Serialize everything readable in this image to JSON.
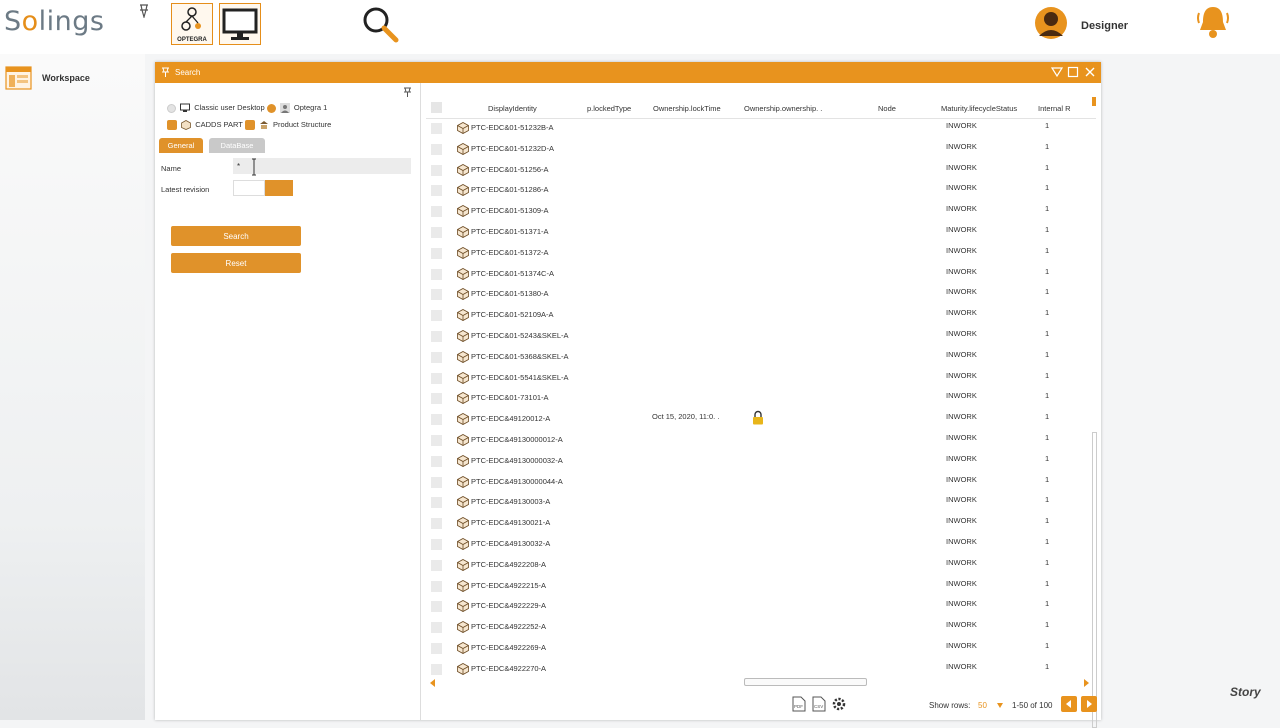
{
  "brand": {
    "logo_prefix": "S",
    "logo_ring": "o",
    "logo_suffix": "lings"
  },
  "apps": {
    "optegra_label": "OPTEGRA"
  },
  "user": {
    "name": "Designer"
  },
  "sidebar": {
    "workspace_label": "Workspace"
  },
  "window": {
    "title": "Search"
  },
  "sources": {
    "classic_desktop": "Classic user Desktop",
    "optegra": "Optegra 1",
    "cadds_part": "CADDS PART",
    "product_structure": "Product Structure"
  },
  "tabs": {
    "general": "General",
    "database": "DataBase"
  },
  "form": {
    "name_label": "Name",
    "name_value": "*",
    "latest_revision_label": "Latest revision",
    "search_button": "Search",
    "reset_button": "Reset"
  },
  "grid": {
    "columns": [
      "DisplayIdentity",
      "p.lockedType",
      "Ownership.lockTime",
      "Ownership.ownership. .",
      "Node",
      "Maturity.lifecycleStatus",
      "Internal R"
    ],
    "rows": [
      {
        "identity": "PTC-EDC&01-51232B-A",
        "lock_time": "",
        "locked": false,
        "status": "INWORK",
        "rev": "1"
      },
      {
        "identity": "PTC-EDC&01-51232D-A",
        "lock_time": "",
        "locked": false,
        "status": "INWORK",
        "rev": "1"
      },
      {
        "identity": "PTC-EDC&01-51256-A",
        "lock_time": "",
        "locked": false,
        "status": "INWORK",
        "rev": "1"
      },
      {
        "identity": "PTC-EDC&01-51286-A",
        "lock_time": "",
        "locked": false,
        "status": "INWORK",
        "rev": "1"
      },
      {
        "identity": "PTC-EDC&01-51309-A",
        "lock_time": "",
        "locked": false,
        "status": "INWORK",
        "rev": "1"
      },
      {
        "identity": "PTC-EDC&01-51371-A",
        "lock_time": "",
        "locked": false,
        "status": "INWORK",
        "rev": "1"
      },
      {
        "identity": "PTC-EDC&01-51372-A",
        "lock_time": "",
        "locked": false,
        "status": "INWORK",
        "rev": "1"
      },
      {
        "identity": "PTC-EDC&01-51374C-A",
        "lock_time": "",
        "locked": false,
        "status": "INWORK",
        "rev": "1"
      },
      {
        "identity": "PTC-EDC&01-51380-A",
        "lock_time": "",
        "locked": false,
        "status": "INWORK",
        "rev": "1"
      },
      {
        "identity": "PTC-EDC&01-52109A-A",
        "lock_time": "",
        "locked": false,
        "status": "INWORK",
        "rev": "1"
      },
      {
        "identity": "PTC-EDC&01-5243&SKEL-A",
        "lock_time": "",
        "locked": false,
        "status": "INWORK",
        "rev": "1"
      },
      {
        "identity": "PTC-EDC&01-5368&SKEL-A",
        "lock_time": "",
        "locked": false,
        "status": "INWORK",
        "rev": "1"
      },
      {
        "identity": "PTC-EDC&01-5541&SKEL-A",
        "lock_time": "",
        "locked": false,
        "status": "INWORK",
        "rev": "1"
      },
      {
        "identity": "PTC-EDC&01-73101-A",
        "lock_time": "",
        "locked": false,
        "status": "INWORK",
        "rev": "1"
      },
      {
        "identity": "PTC-EDC&49120012-A",
        "lock_time": "Oct 15, 2020, 11:0. .",
        "locked": true,
        "status": "INWORK",
        "rev": "1"
      },
      {
        "identity": "PTC-EDC&49130000012-A",
        "lock_time": "",
        "locked": false,
        "status": "INWORK",
        "rev": "1"
      },
      {
        "identity": "PTC-EDC&49130000032-A",
        "lock_time": "",
        "locked": false,
        "status": "INWORK",
        "rev": "1"
      },
      {
        "identity": "PTC-EDC&49130000044-A",
        "lock_time": "",
        "locked": false,
        "status": "INWORK",
        "rev": "1"
      },
      {
        "identity": "PTC-EDC&49130003-A",
        "lock_time": "",
        "locked": false,
        "status": "INWORK",
        "rev": "1"
      },
      {
        "identity": "PTC-EDC&49130021-A",
        "lock_time": "",
        "locked": false,
        "status": "INWORK",
        "rev": "1"
      },
      {
        "identity": "PTC-EDC&49130032-A",
        "lock_time": "",
        "locked": false,
        "status": "INWORK",
        "rev": "1"
      },
      {
        "identity": "PTC-EDC&4922208-A",
        "lock_time": "",
        "locked": false,
        "status": "INWORK",
        "rev": "1"
      },
      {
        "identity": "PTC-EDC&4922215-A",
        "lock_time": "",
        "locked": false,
        "status": "INWORK",
        "rev": "1"
      },
      {
        "identity": "PTC-EDC&4922229-A",
        "lock_time": "",
        "locked": false,
        "status": "INWORK",
        "rev": "1"
      },
      {
        "identity": "PTC-EDC&4922252-A",
        "lock_time": "",
        "locked": false,
        "status": "INWORK",
        "rev": "1"
      },
      {
        "identity": "PTC-EDC&4922269-A",
        "lock_time": "",
        "locked": false,
        "status": "INWORK",
        "rev": "1"
      },
      {
        "identity": "PTC-EDC&4922270-A",
        "lock_time": "",
        "locked": false,
        "status": "INWORK",
        "rev": "1"
      }
    ]
  },
  "footer": {
    "show_rows_label": "Show rows:",
    "show_rows_value": "50",
    "range_text": "1-50 of 100",
    "export_pdf": "PDF",
    "export_csv": "CSV"
  },
  "watermark": "Story",
  "colors": {
    "accent": "#e8931e",
    "status_text": "#333333"
  },
  "icons": [
    "pin-icon",
    "optegra-icon",
    "monitor-icon",
    "magnifier-icon",
    "user-avatar-icon",
    "bell-icon",
    "workspace-icon",
    "filter-icon",
    "maximize-icon",
    "close-icon",
    "part-icon",
    "lock-icon",
    "gear-icon"
  ]
}
